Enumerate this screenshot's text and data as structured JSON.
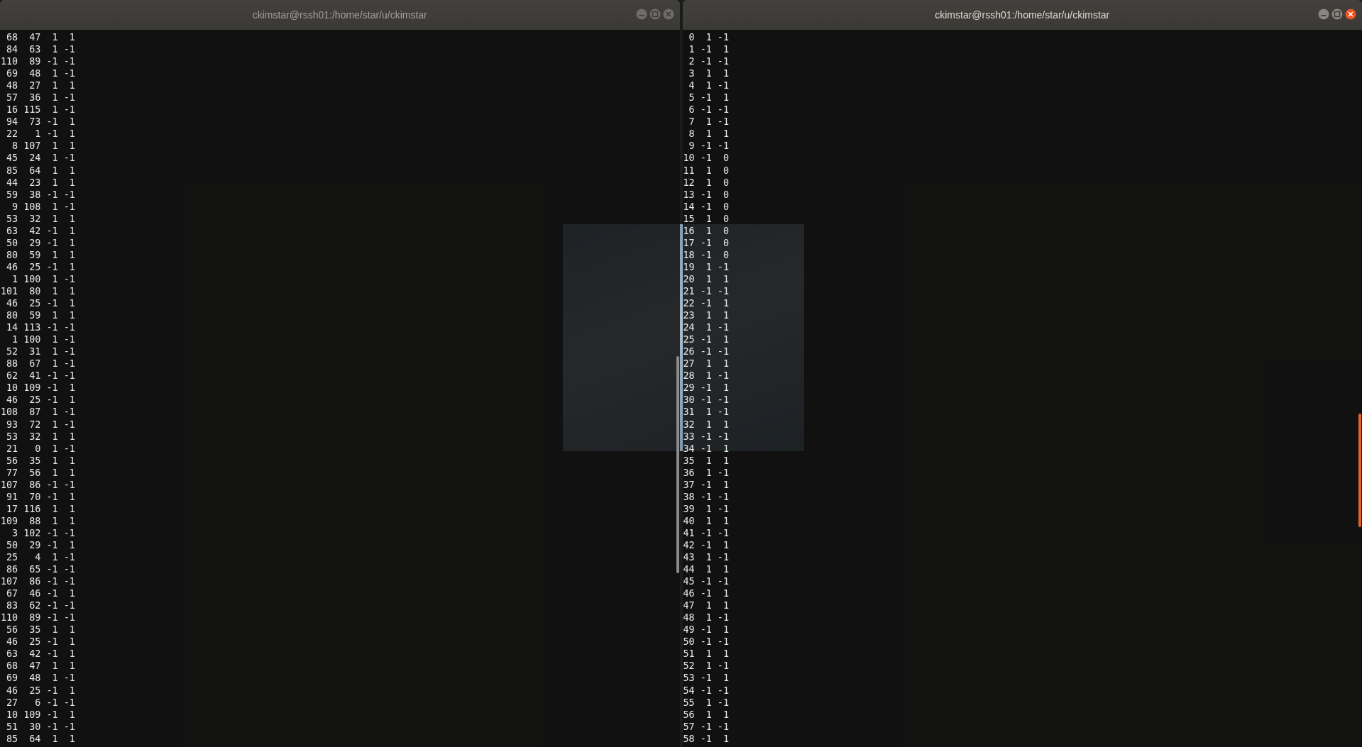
{
  "windows": [
    {
      "title": "ckimstar@rssh01:/home/star/u/ckimstar",
      "active": false,
      "lines": [
        " 68  47  1  1",
        " 84  63  1 -1",
        "110  89 -1 -1",
        " 69  48  1 -1",
        " 48  27  1  1",
        " 57  36  1 -1",
        " 16 115  1 -1",
        " 94  73 -1  1",
        " 22   1 -1  1",
        "  8 107  1  1",
        " 45  24  1 -1",
        " 85  64  1  1",
        " 44  23  1  1",
        " 59  38 -1 -1",
        "  9 108  1 -1",
        " 53  32  1  1",
        " 63  42 -1  1",
        " 50  29 -1  1",
        " 80  59  1  1",
        " 46  25 -1  1",
        "  1 100  1 -1",
        "101  80  1  1",
        " 46  25 -1  1",
        " 80  59  1  1",
        " 14 113 -1 -1",
        "  1 100  1 -1",
        " 52  31  1 -1",
        " 88  67  1 -1",
        " 62  41 -1 -1",
        " 10 109 -1  1",
        " 46  25 -1  1",
        "108  87  1 -1",
        " 93  72  1 -1",
        " 53  32  1  1",
        " 21   0  1 -1",
        " 56  35  1  1",
        " 77  56  1  1",
        "107  86 -1 -1",
        " 91  70 -1  1",
        " 17 116  1  1",
        "109  88  1  1",
        "  3 102 -1 -1",
        " 50  29 -1  1",
        " 25   4  1 -1",
        " 86  65 -1 -1",
        "107  86 -1 -1",
        " 67  46 -1  1",
        " 83  62 -1 -1",
        "110  89 -1 -1",
        " 56  35  1  1",
        " 46  25 -1  1",
        " 63  42 -1  1",
        " 68  47  1  1",
        " 69  48  1 -1",
        " 46  25 -1  1",
        " 27   6 -1 -1",
        " 10 109 -1  1",
        " 51  30 -1 -1",
        " 85  64  1  1"
      ]
    },
    {
      "title": "ckimstar@rssh01:/home/star/u/ckimstar",
      "active": true,
      "lines": [
        " 0  1 -1",
        " 1 -1  1",
        " 2 -1 -1",
        " 3  1  1",
        " 4  1 -1",
        " 5 -1  1",
        " 6 -1 -1",
        " 7  1 -1",
        " 8  1  1",
        " 9 -1 -1",
        "10 -1  0",
        "11  1  0",
        "12  1  0",
        "13 -1  0",
        "14 -1  0",
        "15  1  0",
        "16  1  0",
        "17 -1  0",
        "18 -1  0",
        "19  1 -1",
        "20  1  1",
        "21 -1 -1",
        "22 -1  1",
        "23  1  1",
        "24  1 -1",
        "25 -1  1",
        "26 -1 -1",
        "27  1  1",
        "28  1 -1",
        "29 -1  1",
        "30 -1 -1",
        "31  1 -1",
        "32  1  1",
        "33 -1 -1",
        "34 -1  1",
        "35  1  1",
        "36  1 -1",
        "37 -1  1",
        "38 -1 -1",
        "39  1 -1",
        "40  1  1",
        "41 -1 -1",
        "42 -1  1",
        "43  1 -1",
        "44  1  1",
        "45 -1 -1",
        "46 -1  1",
        "47  1  1",
        "48  1 -1",
        "49 -1  1",
        "50 -1 -1",
        "51  1  1",
        "52  1 -1",
        "53 -1  1",
        "54 -1 -1",
        "55  1 -1",
        "56  1  1",
        "57 -1 -1",
        "58 -1  1"
      ]
    }
  ]
}
